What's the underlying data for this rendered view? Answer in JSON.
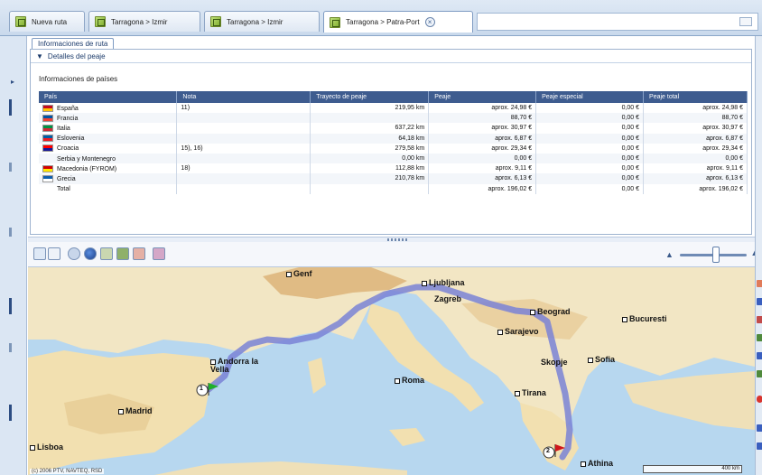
{
  "tabs": [
    {
      "label": "Nueva ruta"
    },
    {
      "label": "Tarragona > Izmir"
    },
    {
      "label": "Tarragona > Izmir"
    },
    {
      "label": "Tarragona > Patra-Port"
    }
  ],
  "panel": {
    "tab_label": "Informaciones de ruta",
    "section_label": "Detalles del peaje",
    "subtitle": "Informaciones de países"
  },
  "table": {
    "headers": [
      "País",
      "Nota",
      "Trayecto de peaje",
      "Peaje",
      "Peaje especial",
      "Peaje total"
    ],
    "rows": [
      {
        "country": "España",
        "flag": [
          "#c60b1e",
          "#ffc400"
        ],
        "note": "11)",
        "distance": "219,95 km",
        "toll": "aprox. 24,98 €",
        "special": "0,00 €",
        "total": "aprox. 24,98 €"
      },
      {
        "country": "Francia",
        "flag": [
          "#0055a4",
          "#ef4135"
        ],
        "note": "",
        "distance": "",
        "toll": "88,70 €",
        "special": "0,00 €",
        "total": "88,70 €"
      },
      {
        "country": "Italia",
        "flag": [
          "#009246",
          "#ce2b37"
        ],
        "note": "",
        "distance": "637,22 km",
        "toll": "aprox. 30,97 €",
        "special": "0,00 €",
        "total": "aprox. 30,97 €"
      },
      {
        "country": "Eslovenia",
        "flag": [
          "#005da4",
          "#ed1c24"
        ],
        "note": "",
        "distance": "64,18 km",
        "toll": "aprox. 6,87 €",
        "special": "0,00 €",
        "total": "aprox. 6,87 €"
      },
      {
        "country": "Croacia",
        "flag": [
          "#ff0000",
          "#171796"
        ],
        "note": "15), 16)",
        "distance": "279,58 km",
        "toll": "aprox. 29,34 €",
        "special": "0,00 €",
        "total": "aprox. 29,34 €"
      },
      {
        "country": "Serbia y Montenegro",
        "flag": [],
        "note": "",
        "distance": "0,00 km",
        "toll": "0,00 €",
        "special": "0,00 €",
        "total": "0,00 €"
      },
      {
        "country": "Macedonia (FYROM)",
        "flag": [
          "#d20000",
          "#ffe600"
        ],
        "note": "18)",
        "distance": "112,88 km",
        "toll": "aprox. 9,11 €",
        "special": "0,00 €",
        "total": "aprox. 9,11 €"
      },
      {
        "country": "Grecia",
        "flag": [
          "#0d5eaf",
          "#ffffff"
        ],
        "note": "",
        "distance": "210,78 km",
        "toll": "aprox. 6,13 €",
        "special": "0,00 €",
        "total": "aprox. 6,13 €"
      },
      {
        "country": "Total",
        "flag": [],
        "note": "",
        "distance": "",
        "toll": "aprox. 196,02 €",
        "special": "0,00 €",
        "total": "aprox. 196,02 €"
      }
    ]
  },
  "map": {
    "cities": [
      "Genf",
      "Ljubljana",
      "Zagreb",
      "Beograd",
      "Bucuresti",
      "Sarajevo",
      "Andorra la Vella",
      "Skopje",
      "Sofia",
      "Roma",
      "Tirana",
      "Madrid",
      "Lisboa",
      "Athina"
    ],
    "start_marker": "1",
    "end_marker": "2",
    "copyright": "(c) 2006 PTV, NAVTEQ, RSD",
    "scale_label": "400 km"
  },
  "colors": {
    "header_blue": "#3e5c8f",
    "route": "#7a82d6",
    "sea": "#b7d7ef",
    "land": "#f2e6c4"
  },
  "icons": [
    "green-flag-icon",
    "red-flag-icon",
    "close-icon",
    "zoom-in-icon",
    "zoom-out-icon",
    "globe-icon",
    "print-icon"
  ]
}
